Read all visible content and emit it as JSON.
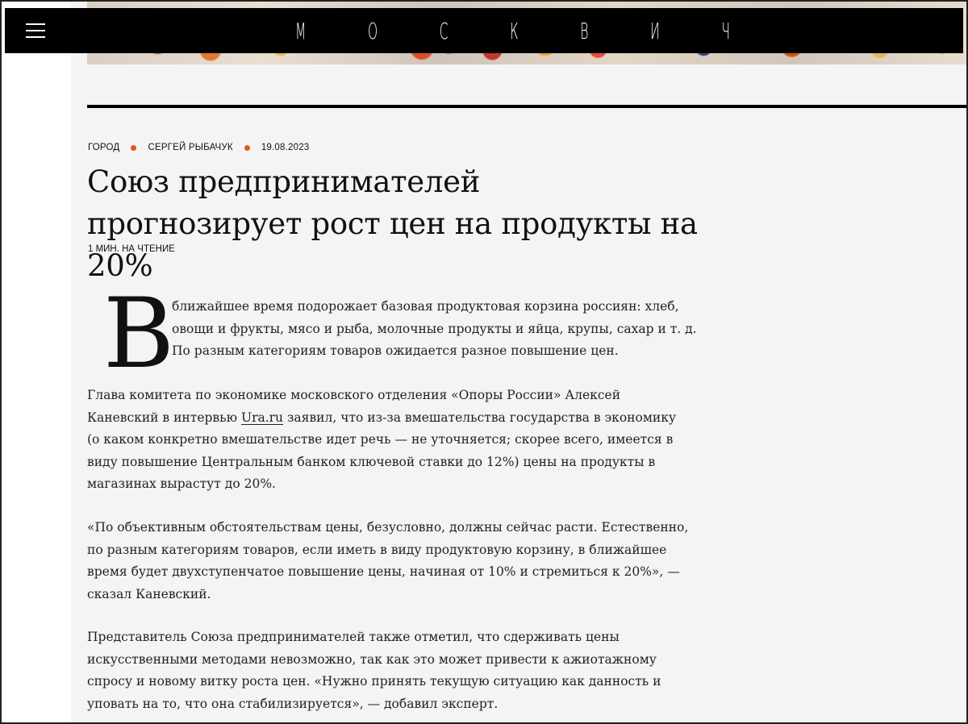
{
  "brand": {
    "logo_letters": [
      "М",
      "О",
      "С",
      "К",
      "В",
      "И",
      "Ч"
    ]
  },
  "article": {
    "rubric": "ГОРОД",
    "author": "СЕРГЕЙ РЫБАЧУК",
    "date": "19.08.2023",
    "title": "Союз предпринимателей прогнозирует рост цен на продукты на 20%",
    "read_time": "1 МИН. НА ЧТЕНИЕ",
    "dropcap": "В",
    "lead_rest": "ближайшее время подорожает базовая продуктовая корзина россиян: хлеб, овощи и фрукты, мясо и рыба, молочные продукты и яйца, крупы, сахар и т. д. По разным категориям товаров ожидается разное повышение цен.",
    "p1_before": "Глава комитета по экономике московского отделения «Опоры России» Алексей Каневский в интервью ",
    "p1_link": "Ura.ru",
    "p1_after": " заявил, что из-за вмешательства государства в экономику (о каком конкретно вмешательстве идет речь — не уточняется; скорее всего, имеется в виду повышение Центральным банком ключевой ставки до 12%) цены на продукты в магазинах вырастут до 20%.",
    "p2": "«По объективным обстоятельствам цены, безусловно, должны сейчас расти. Естественно, по разным категориям товаров, если иметь в виду продуктовую корзину, в ближайшее время будет двухступенчатое повышение цены, начиная от 10% и стремиться к 20%», — сказал Каневский.",
    "p3": "Представитель Союза предпринимателей также отметил, что сдерживать цены искусственными методами невозможно, так как это может привести к ажиотажному спросу и новому витку роста цен. «Нужно принять текущую ситуацию как данность и уповать на то, что она стабилизируется», — добавил эксперт."
  },
  "colors": {
    "accent_dot": "#e0581c",
    "topbar": "#000000",
    "page_bg": "#f4f4f4"
  }
}
